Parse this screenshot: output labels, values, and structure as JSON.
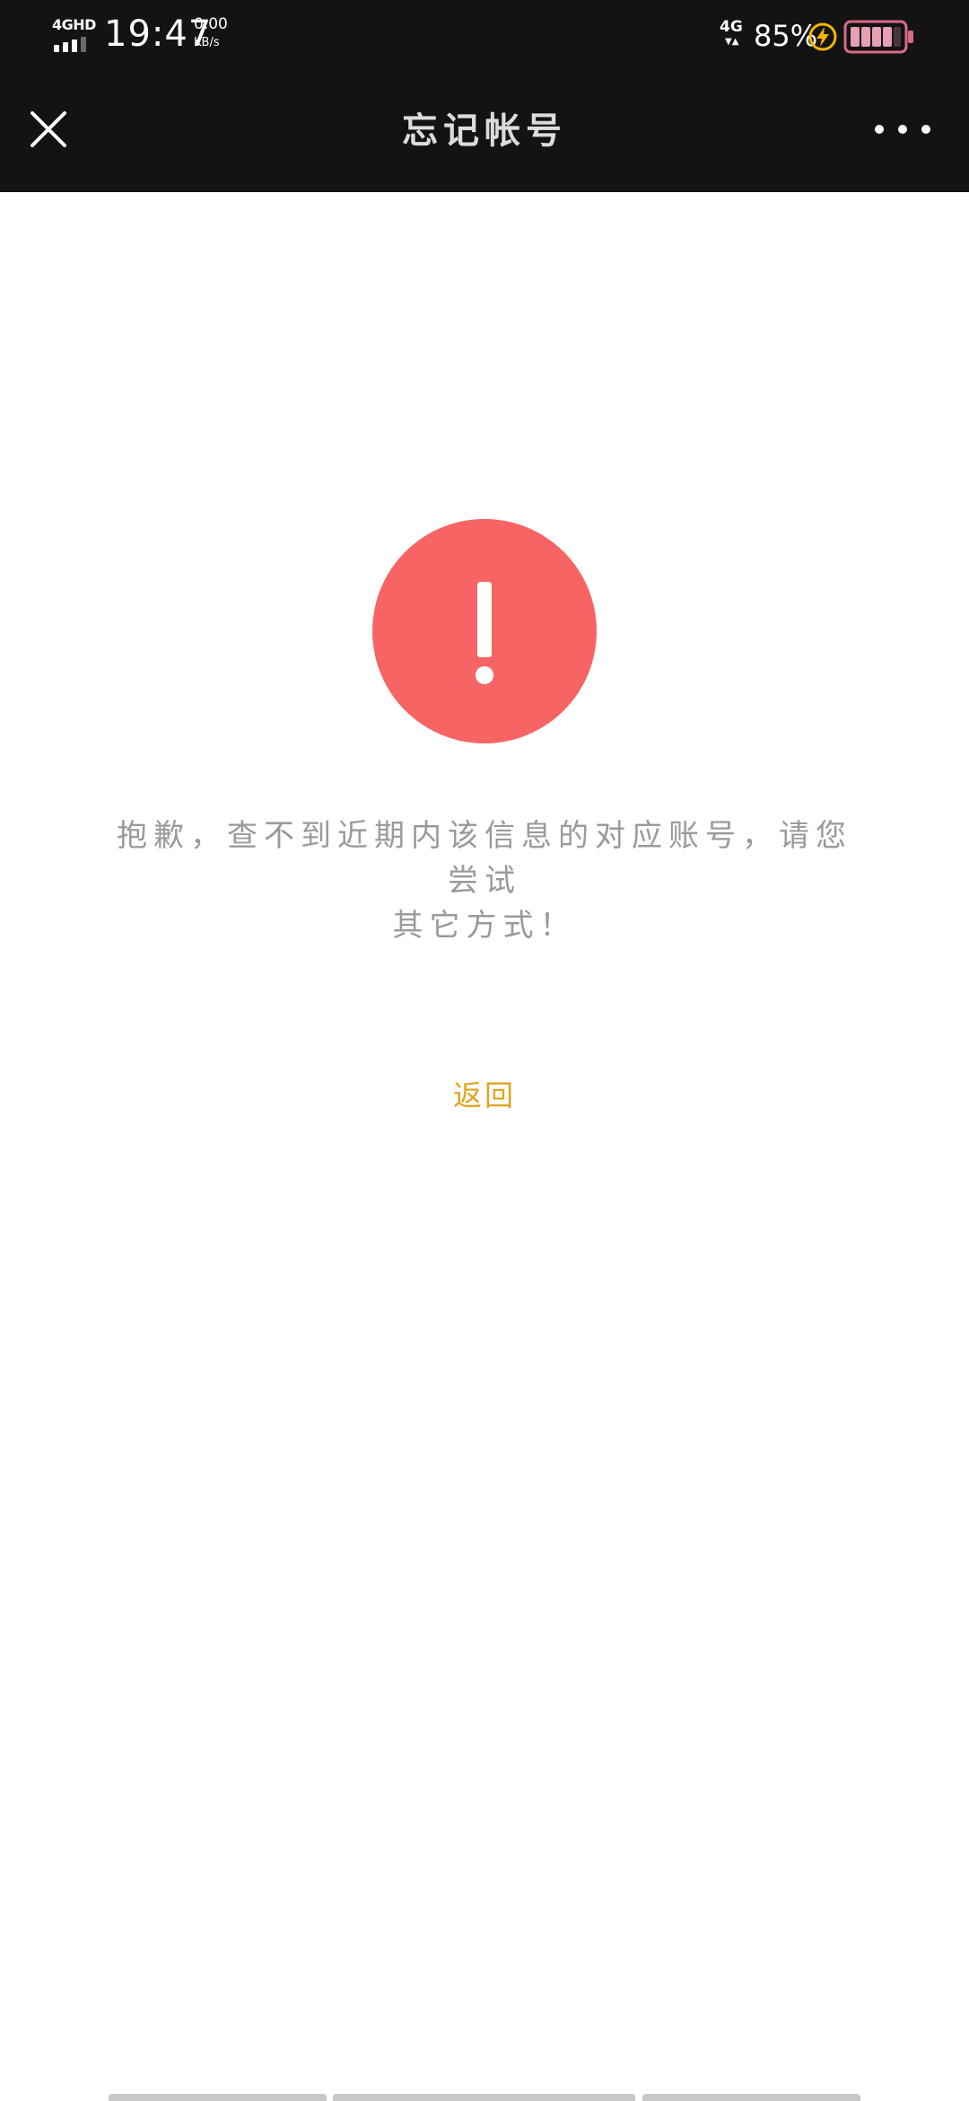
{
  "status_bar": {
    "network_label": "4GHD",
    "time": "19:47",
    "speed_value": "0.00",
    "speed_unit": "KB/s",
    "network_right": "4G",
    "battery_percent": "85%",
    "battery_level": 0.85,
    "icons": [
      "signal-icon",
      "charging-icon",
      "battery-icon"
    ]
  },
  "header": {
    "title": "忘记帐号",
    "close_icon": "close-icon",
    "more_icon": "more-icon"
  },
  "main": {
    "alert_icon": "exclamation-icon",
    "message_line1": "抱歉，查不到近期内该信息的对应账号，请您尝试",
    "message_line2": "其它方式！",
    "back_label": "返回"
  },
  "colors": {
    "bar_bg": "#131313",
    "alert": "#f76464",
    "message": "#9a9a9a",
    "link": "#e0a31d",
    "charge": "#f5b400",
    "battery": "#d96a85"
  }
}
